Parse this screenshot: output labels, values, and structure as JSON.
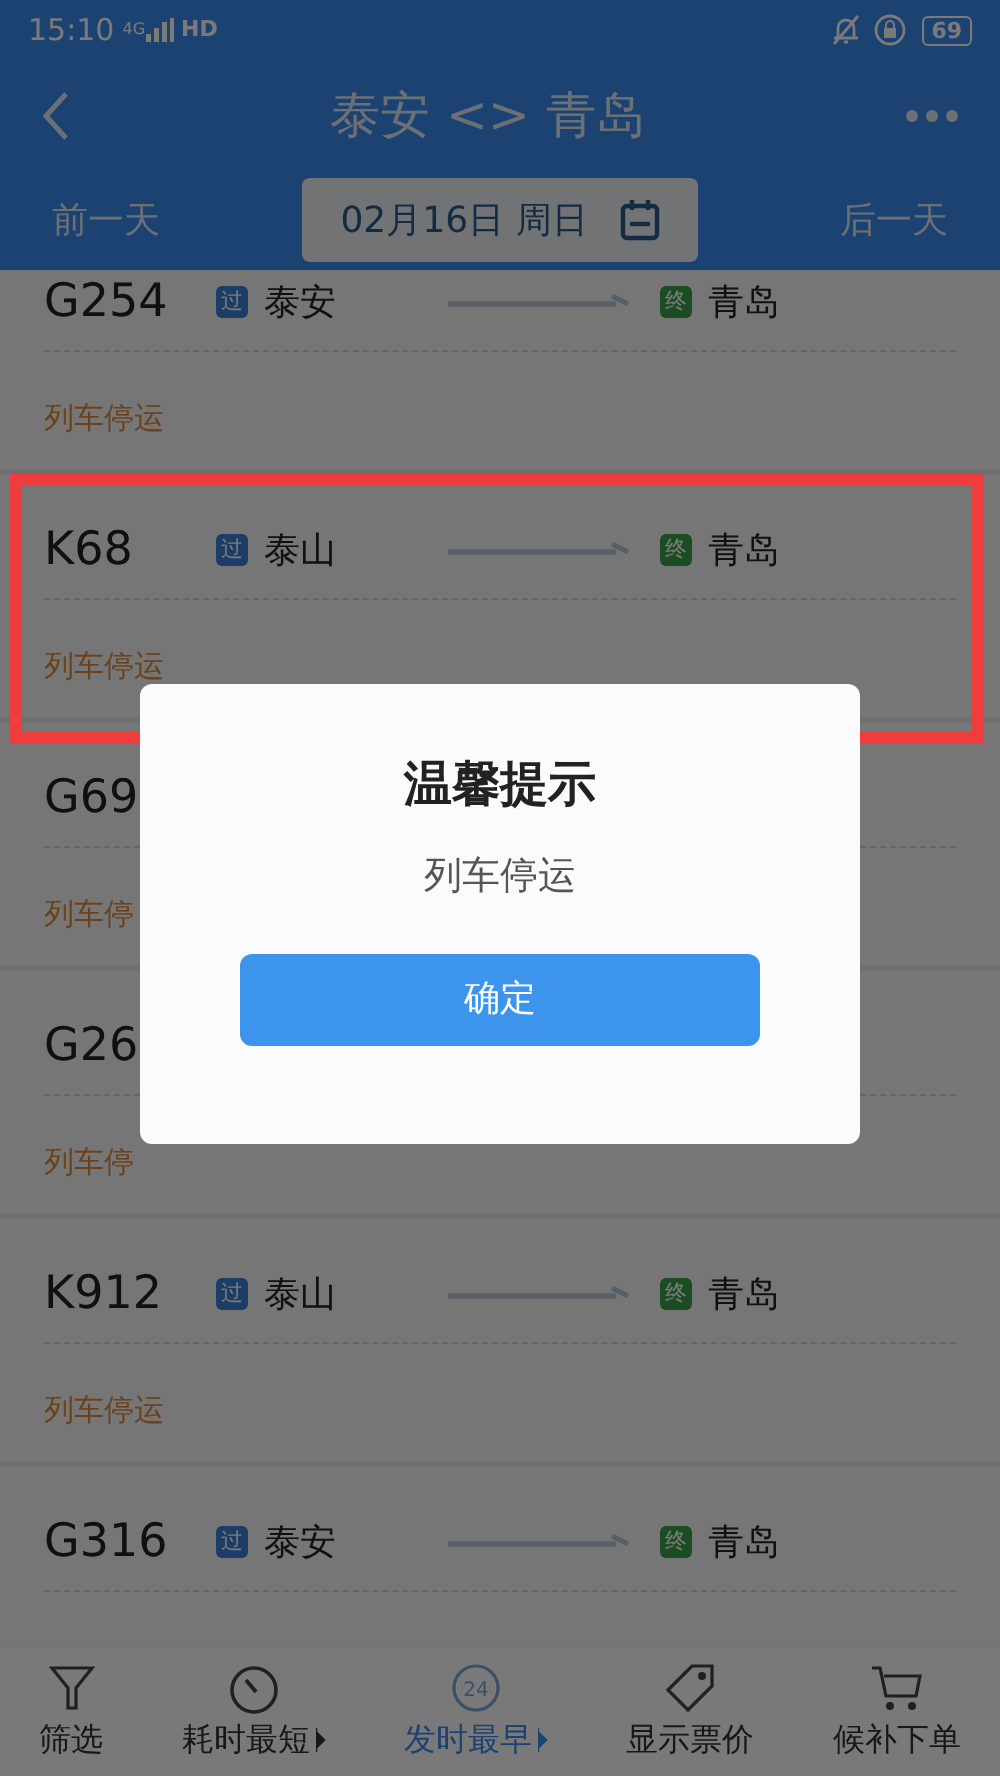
{
  "status_bar": {
    "time": "15:10",
    "network": "4G",
    "hd": "HD",
    "battery": "69"
  },
  "header": {
    "title": "泰安 <> 青岛",
    "prev_day": "前一天",
    "date": "02月16日 周日",
    "next_day": "后一天"
  },
  "trains": [
    {
      "number": "G254",
      "via_badge": "过",
      "from": "泰安",
      "end_badge": "终",
      "to": "青岛",
      "status": "列车停运",
      "highlighted": false
    },
    {
      "number": "K68",
      "via_badge": "过",
      "from": "泰山",
      "end_badge": "终",
      "to": "青岛",
      "status": "列车停运",
      "highlighted": true
    },
    {
      "number": "G69",
      "status": "列车停",
      "highlighted": false
    },
    {
      "number": "G26",
      "status": "列车停",
      "highlighted": false
    },
    {
      "number": "K912",
      "via_badge": "过",
      "from": "泰山",
      "end_badge": "终",
      "to": "青岛",
      "status": "列车停运",
      "highlighted": false
    },
    {
      "number": "G316",
      "via_badge": "过",
      "from": "泰安",
      "end_badge": "终",
      "to": "青岛",
      "highlighted": false
    }
  ],
  "dialog": {
    "title": "温馨提示",
    "message": "列车停运",
    "button": "确定"
  },
  "bottom_tabs": [
    {
      "label": "筛选",
      "kind": "filter",
      "selected": false,
      "sort_caret": false
    },
    {
      "label": "耗时最短",
      "kind": "timer",
      "selected": false,
      "sort_caret": true
    },
    {
      "label": "发时最早",
      "kind": "clock24",
      "icon_label": "24",
      "selected": true,
      "sort_caret": true
    },
    {
      "label": "显示票价",
      "kind": "tag",
      "selected": false,
      "sort_caret": false
    },
    {
      "label": "候补下单",
      "kind": "cart",
      "selected": false,
      "sort_caret": false
    }
  ]
}
